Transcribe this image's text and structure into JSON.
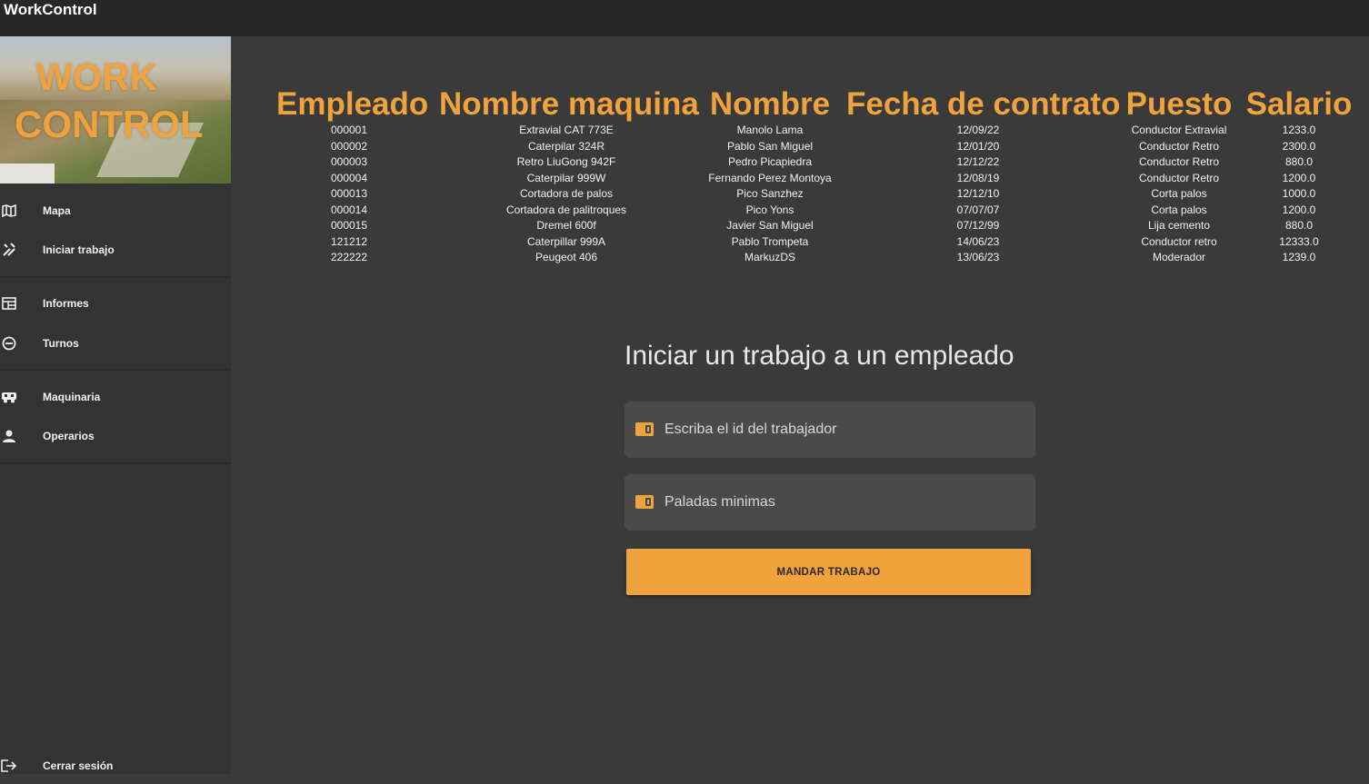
{
  "app": {
    "title": "WorkControl"
  },
  "logo": {
    "line1": "WORK",
    "line2": "CONTROL"
  },
  "sidebar": {
    "items": [
      {
        "label": "Mapa",
        "icon": "map-icon"
      },
      {
        "label": "Iniciar trabajo",
        "icon": "tools-icon"
      },
      {
        "label": "Informes",
        "icon": "report-icon"
      },
      {
        "label": "Turnos",
        "icon": "shift-icon"
      },
      {
        "label": "Maquinaria",
        "icon": "machinery-icon"
      },
      {
        "label": "Operarios",
        "icon": "person-icon"
      }
    ],
    "logout": {
      "label": "Cerrar sesión",
      "icon": "logout-icon"
    }
  },
  "table": {
    "headers": [
      "Empleado",
      "Nombre maquina",
      "Nombre",
      "Fecha de contrato",
      "Puesto",
      "Salario"
    ],
    "rows": [
      [
        "000001",
        "Extravial CAT 773E",
        "Manolo Lama",
        "12/09/22",
        "Conductor Extravial",
        "1233.0"
      ],
      [
        "000002",
        "Caterpilar 324R",
        "Pablo San Miguel",
        "12/01/20",
        "Conductor Retro",
        "2300.0"
      ],
      [
        "000003",
        "Retro LiuGong 942F",
        "Pedro Picapiedra",
        "12/12/22",
        "Conductor Retro",
        "880.0"
      ],
      [
        "000004",
        "Caterpilar 999W",
        "Fernando Perez Montoya",
        "12/08/19",
        "Conductor Retro",
        "1200.0"
      ],
      [
        "000013",
        "Cortadora de palos",
        "Pico Sanzhez",
        "12/12/10",
        "Corta palos",
        "1000.0"
      ],
      [
        "000014",
        "Cortadora de palitroques",
        "Pico Yons",
        "07/07/07",
        "Corta palos",
        "1200.0"
      ],
      [
        "000015",
        "Dremel 600f",
        "Javier San Miguel",
        "07/12/99",
        "Lija cemento",
        "880.0"
      ],
      [
        "121212",
        "Caterpillar 999A",
        "Pablo Trompeta",
        "14/06/23",
        "Conductor retro",
        "12333.0"
      ],
      [
        "222222",
        "Peugeot 406",
        "MarkuzDS",
        "13/06/23",
        "Moderador",
        "1239.0"
      ]
    ]
  },
  "form": {
    "title": "Iniciar un trabajo a un empleado",
    "worker_placeholder": "Escriba el id del trabajador",
    "min_placeholder": "Paladas minimas",
    "submit_label": "MANDAR TRABAJO"
  },
  "colors": {
    "accent": "#f0a23c",
    "background": "#3a3a3a",
    "sidebar": "#333333",
    "titlebar": "#272727"
  }
}
